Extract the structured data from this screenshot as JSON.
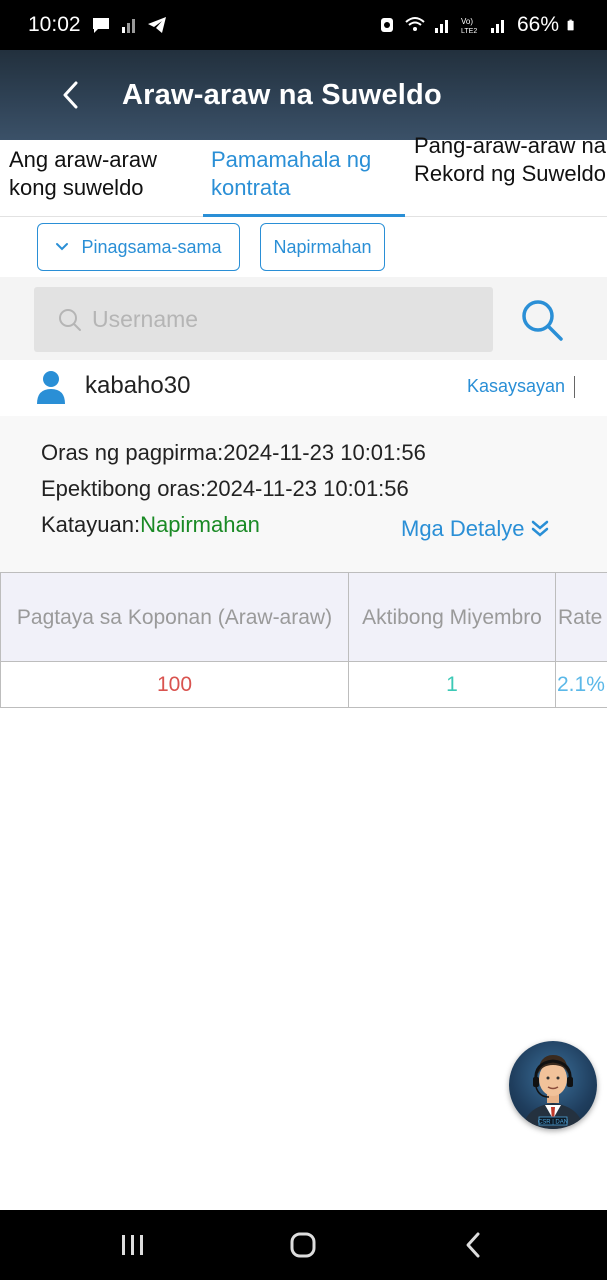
{
  "status_bar": {
    "time": "10:02",
    "battery": "66%",
    "icons": [
      "chat-icon",
      "signal-icon",
      "telegram-icon",
      "alarm-icon",
      "wifi-icon",
      "signal-icon",
      "volte-icon",
      "battery-icon"
    ]
  },
  "header": {
    "title": "Araw-araw na Suweldo",
    "back_icon": "chevron-left-icon"
  },
  "tabs": [
    {
      "label": "Ang araw-araw kong suweldo",
      "active": false
    },
    {
      "label": "Pamamahala ng kontrata",
      "active": true
    },
    {
      "label": "Pang-araw-araw na Rekord ng Suweldo",
      "active": false
    }
  ],
  "filters": {
    "combined_label": "Pinagsama-sama",
    "signed_label": "Napirmahan"
  },
  "search": {
    "placeholder": "Username",
    "value": ""
  },
  "user": {
    "name": "kabaho30",
    "history_link": "Kasaysayan"
  },
  "details": {
    "sign_time_label": "Oras ng pagpirma:",
    "sign_time_value": "2024-11-23 10:01:56",
    "effective_time_label": "Epektibong oras:",
    "effective_time_value": "2024-11-23 10:01:56",
    "status_label": "Katayuan:",
    "status_value": "Napirmahan",
    "more_label": "Mga Detalye"
  },
  "table": {
    "headers": [
      "Pagtaya sa Koponan (Araw-araw)",
      "Aktibong Miyembro",
      "Rate"
    ],
    "rows": [
      [
        "100",
        "1",
        "2.1%"
      ]
    ]
  },
  "colors": {
    "accent": "#2a8fd6",
    "header_bg": "#2f4255",
    "status_green": "#1a8a25",
    "value_red": "#d9534f",
    "value_teal": "#3cc9b6"
  },
  "nav": [
    "recent-apps-icon",
    "home-icon",
    "back-icon"
  ]
}
